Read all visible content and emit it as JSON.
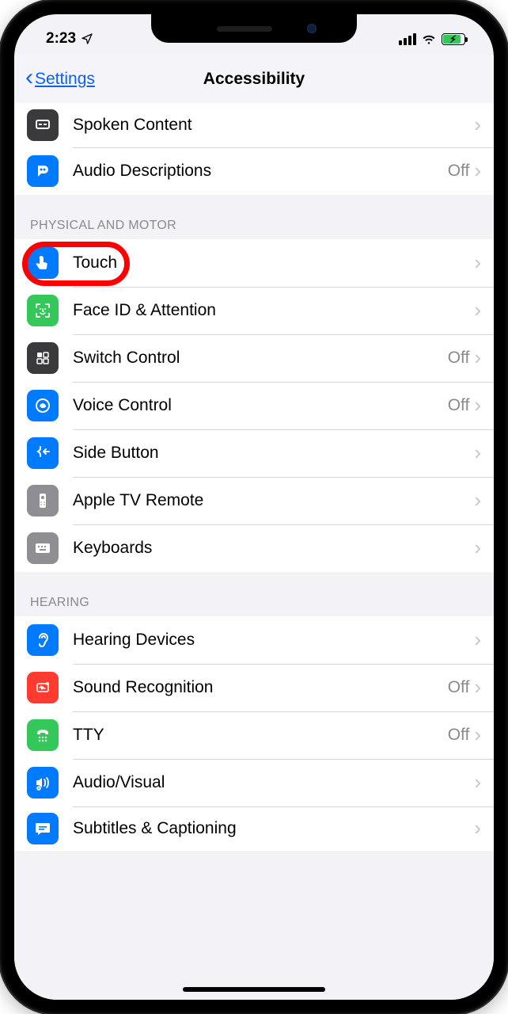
{
  "status": {
    "time": "2:23"
  },
  "nav": {
    "back": "Settings",
    "title": "Accessibility"
  },
  "partialGroup": {
    "rows": [
      {
        "label": "Spoken Content",
        "value": ""
      },
      {
        "label": "Audio Descriptions",
        "value": "Off"
      }
    ]
  },
  "sections": [
    {
      "header": "PHYSICAL AND MOTOR",
      "rows": [
        {
          "label": "Touch",
          "value": "",
          "icon": "touch",
          "iconBg": "bg-blue",
          "highlight": true
        },
        {
          "label": "Face ID & Attention",
          "value": "",
          "icon": "faceid",
          "iconBg": "bg-green"
        },
        {
          "label": "Switch Control",
          "value": "Off",
          "icon": "switch",
          "iconBg": "bg-darkgray"
        },
        {
          "label": "Voice Control",
          "value": "Off",
          "icon": "voice",
          "iconBg": "bg-blue"
        },
        {
          "label": "Side Button",
          "value": "",
          "icon": "side",
          "iconBg": "bg-blue"
        },
        {
          "label": "Apple TV Remote",
          "value": "",
          "icon": "remote",
          "iconBg": "bg-gray"
        },
        {
          "label": "Keyboards",
          "value": "",
          "icon": "keyboard",
          "iconBg": "bg-gray"
        }
      ]
    },
    {
      "header": "HEARING",
      "rows": [
        {
          "label": "Hearing Devices",
          "value": "",
          "icon": "ear",
          "iconBg": "bg-blue"
        },
        {
          "label": "Sound Recognition",
          "value": "Off",
          "icon": "sound",
          "iconBg": "bg-red"
        },
        {
          "label": "TTY",
          "value": "Off",
          "icon": "tty",
          "iconBg": "bg-green"
        },
        {
          "label": "Audio/Visual",
          "value": "",
          "icon": "audiovisual",
          "iconBg": "bg-blue"
        },
        {
          "label": "Subtitles & Captioning",
          "value": "",
          "icon": "subtitles",
          "iconBg": "bg-blue"
        }
      ]
    }
  ],
  "valueOffText": "Off"
}
